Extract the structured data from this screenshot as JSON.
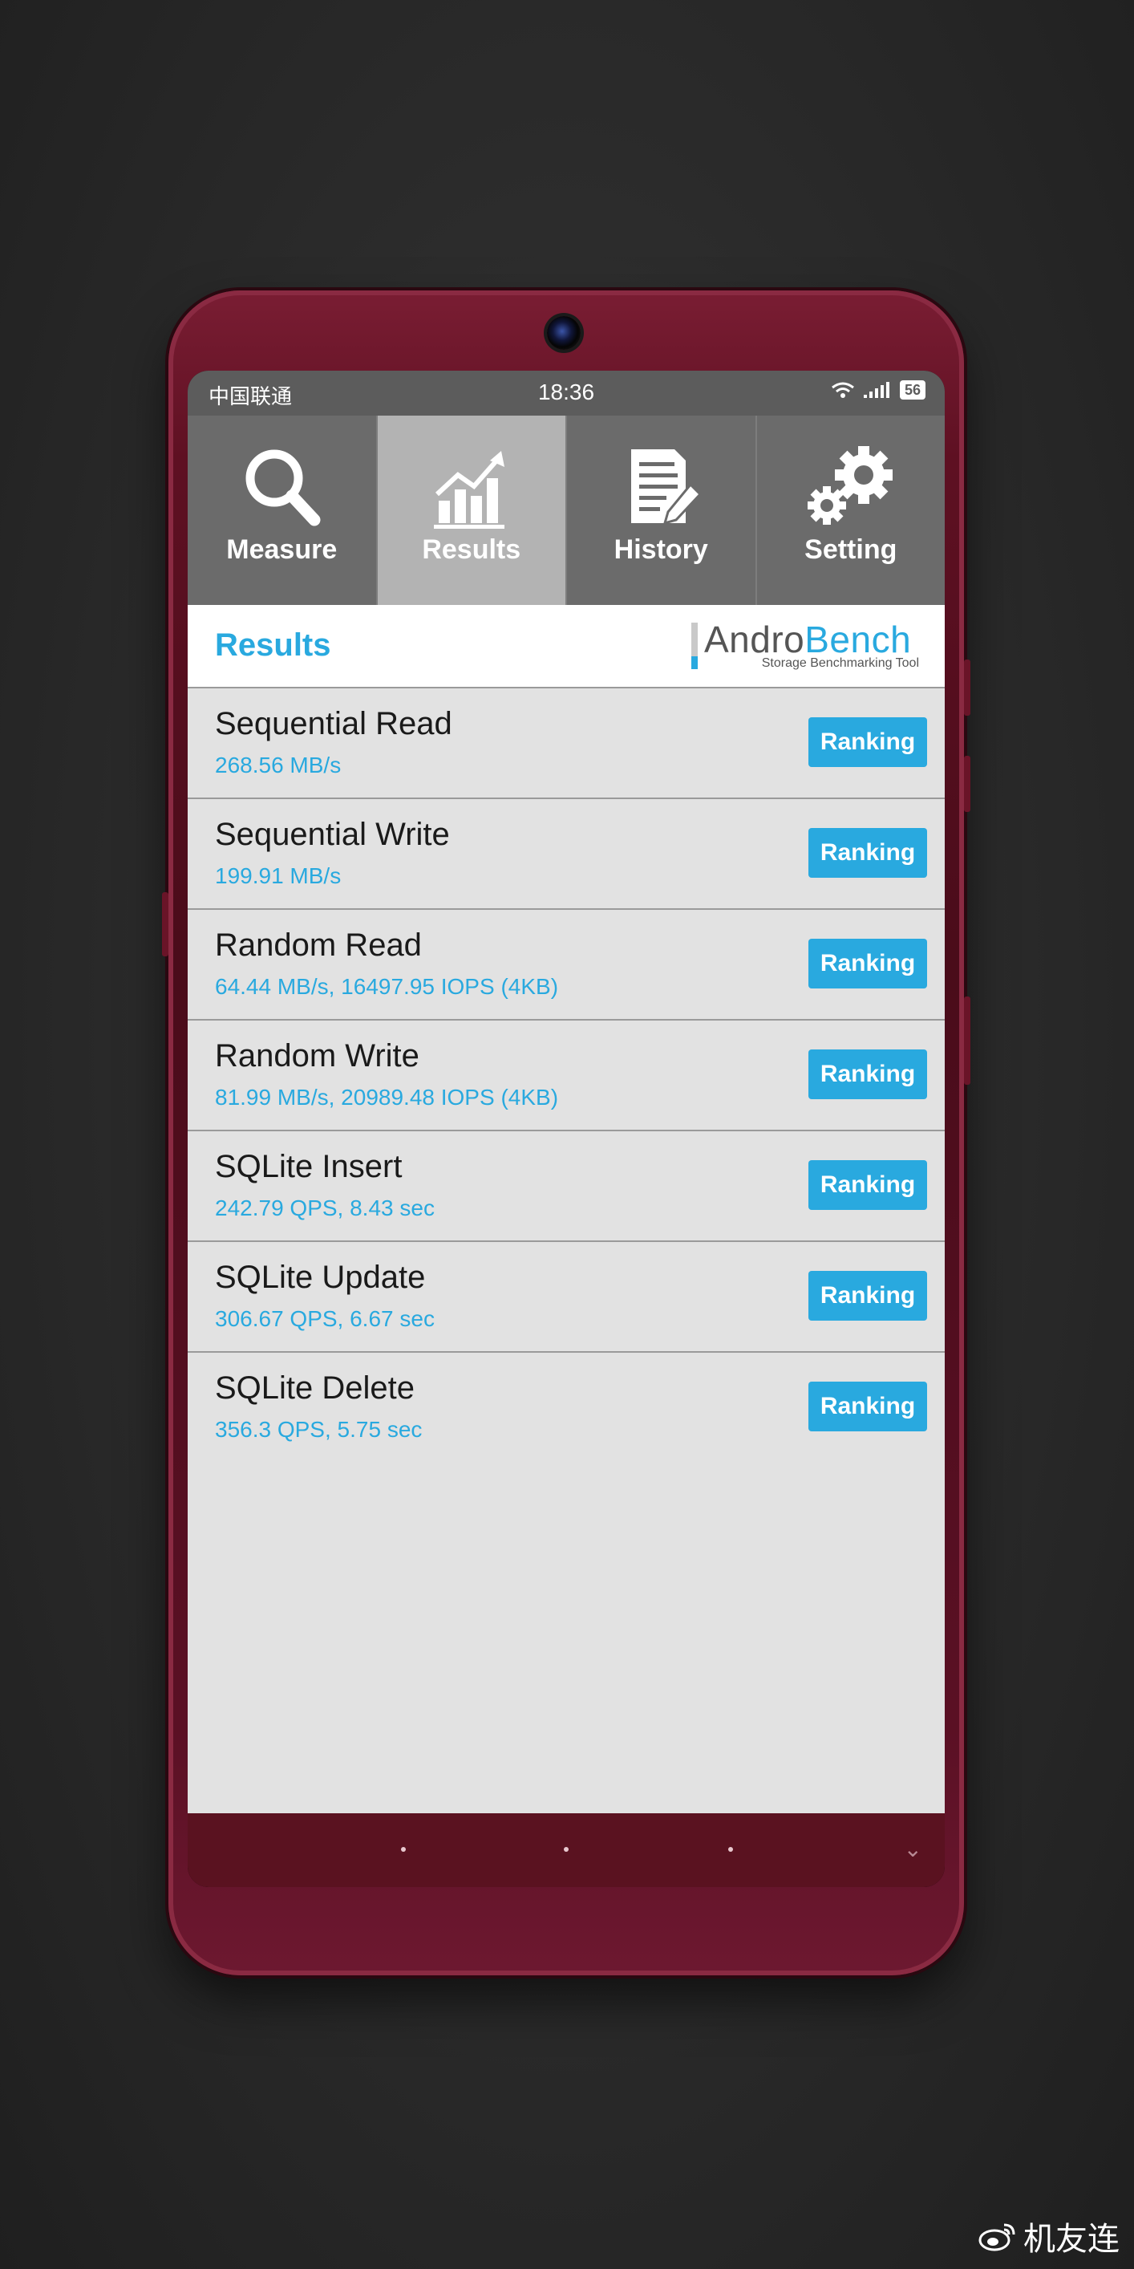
{
  "status_bar": {
    "carrier": "中国联通",
    "time": "18:36",
    "battery": "56"
  },
  "tabs": [
    {
      "label": "Measure",
      "icon": "magnifier-icon",
      "active": false
    },
    {
      "label": "Results",
      "icon": "chart-icon",
      "active": true
    },
    {
      "label": "History",
      "icon": "document-icon",
      "active": false
    },
    {
      "label": "Setting",
      "icon": "gears-icon",
      "active": false
    }
  ],
  "header": {
    "title": "Results",
    "logo_andro": "Andro",
    "logo_bench": "Bench",
    "logo_tagline": "Storage Benchmarking Tool"
  },
  "results": [
    {
      "name": "Sequential Read",
      "value": "268.56 MB/s",
      "button": "Ranking"
    },
    {
      "name": "Sequential Write",
      "value": "199.91 MB/s",
      "button": "Ranking"
    },
    {
      "name": "Random Read",
      "value": "64.44 MB/s, 16497.95 IOPS (4KB)",
      "button": "Ranking"
    },
    {
      "name": "Random Write",
      "value": "81.99 MB/s, 20989.48 IOPS (4KB)",
      "button": "Ranking"
    },
    {
      "name": "SQLite Insert",
      "value": "242.79 QPS, 8.43 sec",
      "button": "Ranking"
    },
    {
      "name": "SQLite Update",
      "value": "306.67 QPS, 6.67 sec",
      "button": "Ranking"
    },
    {
      "name": "SQLite Delete",
      "value": "356.3 QPS, 5.75 sec",
      "button": "Ranking"
    }
  ],
  "nav_bar": {
    "chevron": "⌄"
  },
  "watermark": "机友连",
  "colors": {
    "accent": "#29a9df",
    "phone_body": "#5e1022",
    "tab_bar": "#6b6b6b",
    "tab_active": "#b3b3b3"
  }
}
